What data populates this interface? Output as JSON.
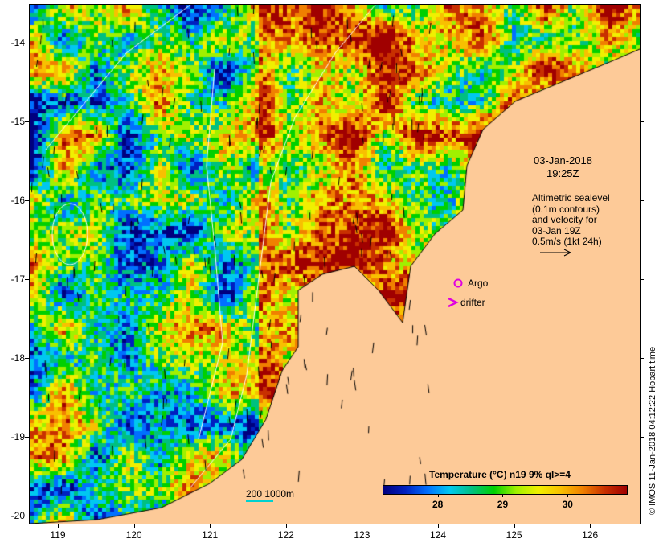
{
  "map": {
    "lat_ticks": [
      "-14",
      "-15",
      "-16",
      "-17",
      "-18",
      "-19",
      "-20"
    ],
    "lon_ticks": [
      "119",
      "120",
      "121",
      "122",
      "123",
      "124",
      "125",
      "126"
    ],
    "date": "03-Jan-2018",
    "time": "19:25Z",
    "legend_lines": [
      "Altimetric sealevel",
      "(0.1m contours)",
      "and velocity for",
      "03-Jan 19Z",
      "0.5m/s (1kt 24h)"
    ],
    "argo_label": "Argo",
    "drifter_label": "drifter",
    "scale_label": "200  1000m",
    "credit": "© IMOS 11-Jan-2018 04:12:22 Hobart time",
    "land_color": "#fdca98"
  },
  "colorbar": {
    "title": "Temperature (°C) n19 9% ql>=4",
    "ticks": [
      "28",
      "29",
      "30"
    ],
    "range": [
      27.15,
      30.9
    ],
    "colors": [
      "#00007f",
      "#0020c0",
      "#0070ff",
      "#00c8f0",
      "#00c080",
      "#00d000",
      "#a0f000",
      "#f0f000",
      "#f8c000",
      "#f08000",
      "#c83000",
      "#a00000"
    ]
  }
}
